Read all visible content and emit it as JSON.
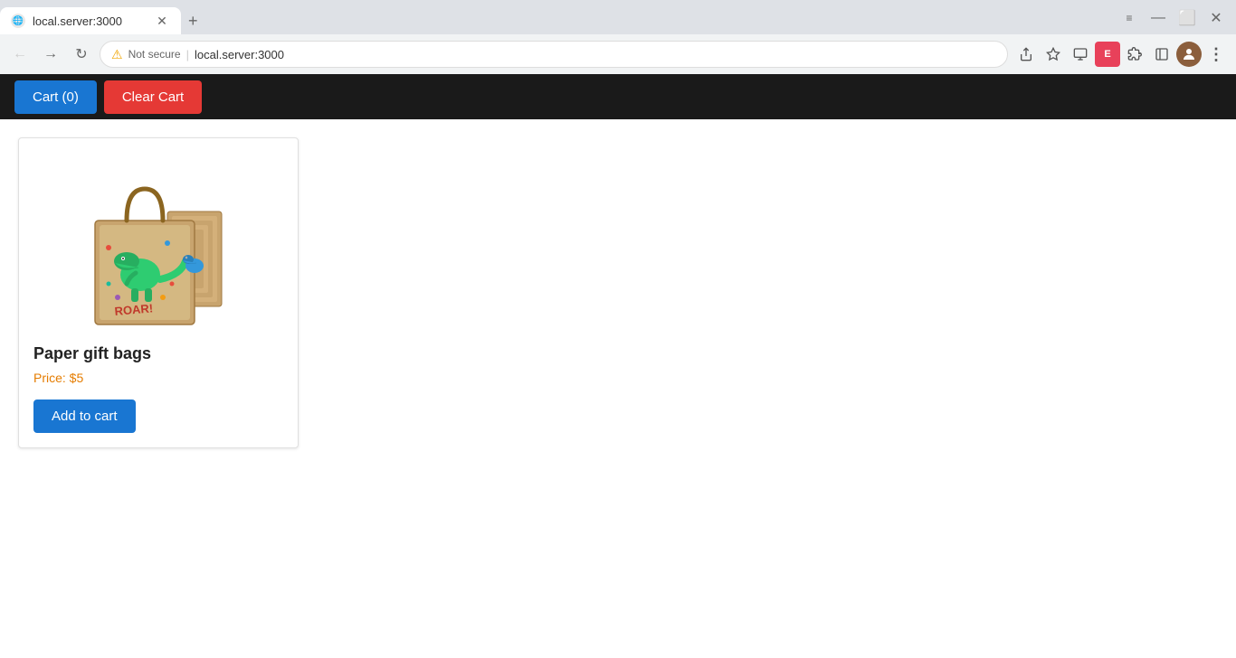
{
  "browser": {
    "tab": {
      "favicon": "🌐",
      "title": "local.server:3000",
      "close_icon": "✕"
    },
    "new_tab_icon": "+",
    "toolbar": {
      "back_icon": "←",
      "forward_icon": "→",
      "reload_icon": "↻",
      "warning_icon": "⚠",
      "not_secure_label": "Not secure",
      "separator": "|",
      "url": "local.server:3000",
      "share_icon": "⬆",
      "bookmark_icon": "☆",
      "downloads_icon": "⬇",
      "extensions_icon": "🧩",
      "puzzle_icon": "🧩",
      "sidebar_icon": "▣",
      "profile_icon": "👤",
      "menu_icon": "⋮"
    }
  },
  "navbar": {
    "cart_label": "Cart (0)",
    "clear_cart_label": "Clear Cart"
  },
  "product": {
    "name": "Paper gift bags",
    "price_label": "Price: $5",
    "add_to_cart_label": "Add to cart"
  }
}
